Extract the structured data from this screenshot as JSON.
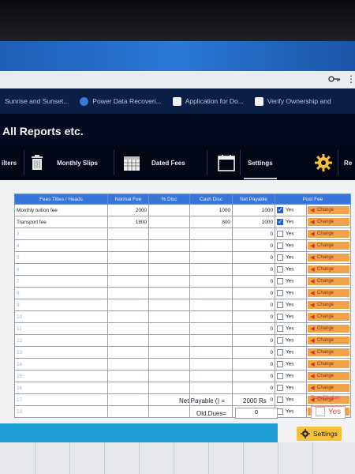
{
  "browser": {
    "bookmarks": [
      {
        "label": "Sunrise and Sunset..."
      },
      {
        "label": "Power Data Recoveri..."
      },
      {
        "label": "Application for Do..."
      },
      {
        "label": "Verify Ownership and"
      }
    ]
  },
  "app": {
    "title": "All Reports etc."
  },
  "toolbar": {
    "items": [
      {
        "label": "ilters"
      },
      {
        "label": "Monthly Slips"
      },
      {
        "label": "Dated Fees"
      },
      {
        "label": "Settings"
      },
      {
        "label": "Re"
      }
    ]
  },
  "table": {
    "headers": [
      "Fees Titles / Heads",
      "Normal Fee",
      "% Disc",
      "Cash Disc",
      "Net Payable",
      "Post Fee"
    ],
    "rows": [
      {
        "title": "Monthly tuition fee",
        "normal": "2000",
        "disc": "",
        "cash": "1000",
        "net": "1000",
        "checked": true,
        "yes": "Yes",
        "change": "Change"
      },
      {
        "title": "Transport fee",
        "normal": "1800",
        "disc": "",
        "cash": "800",
        "net": "1000",
        "checked": true,
        "yes": "Yes",
        "change": "Change"
      },
      {
        "title": "3",
        "normal": "",
        "disc": "",
        "cash": "",
        "net": "0",
        "checked": false,
        "yes": "Yes",
        "change": "Change"
      },
      {
        "title": "4",
        "normal": "",
        "disc": "",
        "cash": "",
        "net": "0",
        "checked": false,
        "yes": "Yes",
        "change": "Change"
      },
      {
        "title": "5",
        "normal": "",
        "disc": "",
        "cash": "",
        "net": "0",
        "checked": false,
        "yes": "Yes",
        "change": "Change"
      },
      {
        "title": "6",
        "normal": "",
        "disc": "",
        "cash": "",
        "net": "0",
        "checked": false,
        "yes": "Yes",
        "change": "Change"
      },
      {
        "title": "7",
        "normal": "",
        "disc": "",
        "cash": "",
        "net": "0",
        "checked": false,
        "yes": "Yes",
        "change": "Change"
      },
      {
        "title": "8",
        "normal": "",
        "disc": "",
        "cash": "",
        "net": "0",
        "checked": false,
        "yes": "Yes",
        "change": "Change"
      },
      {
        "title": "9",
        "normal": "",
        "disc": "",
        "cash": "",
        "net": "0",
        "checked": false,
        "yes": "Yes",
        "change": "Change"
      },
      {
        "title": "10",
        "normal": "",
        "disc": "",
        "cash": "",
        "net": "0",
        "checked": false,
        "yes": "Yes",
        "change": "Change"
      },
      {
        "title": "11",
        "normal": "",
        "disc": "",
        "cash": "",
        "net": "0",
        "checked": false,
        "yes": "Yes",
        "change": "Change"
      },
      {
        "title": "12",
        "normal": "",
        "disc": "",
        "cash": "",
        "net": "0",
        "checked": false,
        "yes": "Yes",
        "change": "Change"
      },
      {
        "title": "13",
        "normal": "",
        "disc": "",
        "cash": "",
        "net": "0",
        "checked": false,
        "yes": "Yes",
        "change": "Change"
      },
      {
        "title": "14",
        "normal": "",
        "disc": "",
        "cash": "",
        "net": "0",
        "checked": false,
        "yes": "Yes",
        "change": "Change"
      },
      {
        "title": "15",
        "normal": "",
        "disc": "",
        "cash": "",
        "net": "0",
        "checked": false,
        "yes": "Yes",
        "change": "Change"
      },
      {
        "title": "16",
        "normal": "",
        "disc": "",
        "cash": "",
        "net": "0",
        "checked": false,
        "yes": "Yes",
        "change": "Change"
      },
      {
        "title": "17",
        "normal": "",
        "disc": "",
        "cash": "",
        "net": "0",
        "checked": false,
        "yes": "Yes",
        "change": "Change"
      },
      {
        "title": "18",
        "normal": "",
        "disc": "",
        "cash": "",
        "net": "0",
        "checked": false,
        "yes": "Yes",
        "change": "Change"
      }
    ]
  },
  "summary": {
    "net_payable_label": "Net Payable () =",
    "net_payable_value": "2000 Rs",
    "old_dues_label": "Old.Dues=",
    "old_dues_value": "0",
    "post_challan_label": "Post Challan",
    "post_challan_yes": "Yes"
  },
  "statusbar": {
    "settings_label": "Settings"
  },
  "colors": {
    "header_blue": "#3776d6",
    "change_orange": "#f0a24a",
    "status_cyan": "#1ea0d6",
    "accent_red": "#e04a52"
  },
  "icons": [
    "key-icon",
    "trash-icon",
    "calendar-icon",
    "gear-icon",
    "checkmark-icon",
    "arrow-left-icon"
  ]
}
